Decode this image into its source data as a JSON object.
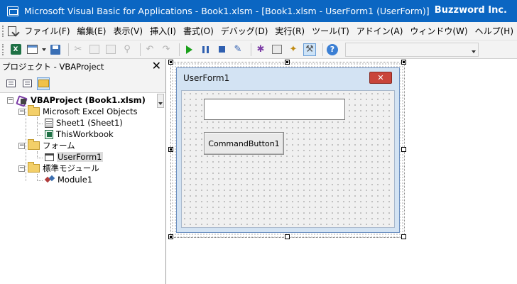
{
  "window": {
    "title": "Microsoft Visual Basic for Applications - Book1.xlsm - [Book1.xlsm - UserForm1 (UserForm)]",
    "brand": "Buzzword Inc."
  },
  "menubar": {
    "items": [
      {
        "label": "ファイル(F)"
      },
      {
        "label": "編集(E)"
      },
      {
        "label": "表示(V)"
      },
      {
        "label": "挿入(I)"
      },
      {
        "label": "書式(O)"
      },
      {
        "label": "デバッグ(D)"
      },
      {
        "label": "実行(R)"
      },
      {
        "label": "ツール(T)"
      },
      {
        "label": "アドイン(A)"
      },
      {
        "label": "ウィンドウ(W)"
      },
      {
        "label": "ヘルプ(H)"
      }
    ]
  },
  "toolbar": {
    "excel_glyph": "X",
    "help_glyph": "?"
  },
  "project": {
    "title": "プロジェクト - VBAProject",
    "close_glyph": "✕",
    "tree": {
      "root": "VBAProject (Book1.xlsm)",
      "excel_objects": "Microsoft Excel Objects",
      "sheet1": "Sheet1 (Sheet1)",
      "thisworkbook": "ThisWorkbook",
      "forms": "フォーム",
      "userform1": "UserForm1",
      "modules": "標準モジュール",
      "module1": "Module1",
      "minus": "−"
    }
  },
  "userform": {
    "caption": "UserForm1",
    "close_glyph": "✕",
    "textbox_value": "",
    "button_label": "CommandButton1"
  }
}
